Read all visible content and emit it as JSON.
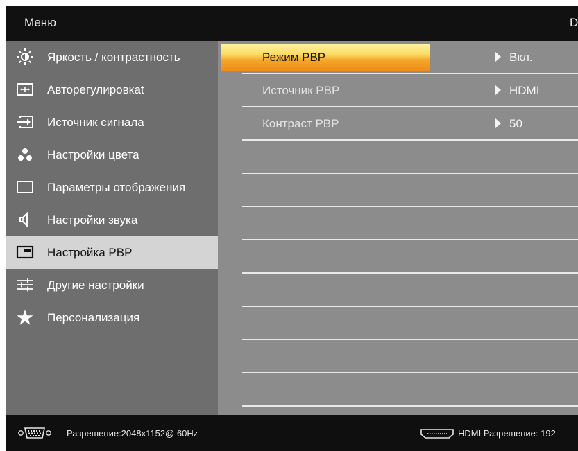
{
  "header": {
    "title": "Меню",
    "brand": "D"
  },
  "sidebar": {
    "items": [
      {
        "label": "Яркость / контрастность",
        "icon": "sun-icon"
      },
      {
        "label": "Авторегулировкаt",
        "icon": "auto-adjust-icon"
      },
      {
        "label": "Источник сигнала",
        "icon": "input-source-icon"
      },
      {
        "label": "Настройки цвета",
        "icon": "color-dots-icon"
      },
      {
        "label": "Параметры отображения",
        "icon": "display-icon"
      },
      {
        "label": "Настройки звука",
        "icon": "speaker-icon"
      },
      {
        "label": "Настройка PBP",
        "icon": "pbp-icon",
        "active": true
      },
      {
        "label": "Другие настройки",
        "icon": "sliders-icon"
      },
      {
        "label": "Персонализация",
        "icon": "star-icon"
      }
    ]
  },
  "settings": {
    "rows": [
      {
        "name": "Режим PBP",
        "value": "Вкл.",
        "selected": true
      },
      {
        "name": "Источник PBP",
        "value": "HDMI"
      },
      {
        "name": "Контраст PBP",
        "value": "50"
      }
    ]
  },
  "footer": {
    "left_resolution": "Разрешение:2048x1152@ 60Hz",
    "right_resolution": "HDMI Разрешение: 192"
  },
  "colors": {
    "osd_background": "#0d0d0d",
    "sidebar_background": "#6e6e6e",
    "sidebar_active": "#d4d4d4",
    "content_background": "#8c8c8c",
    "highlight_top": "#fbdc62",
    "highlight_bottom": "#ef8b17"
  }
}
